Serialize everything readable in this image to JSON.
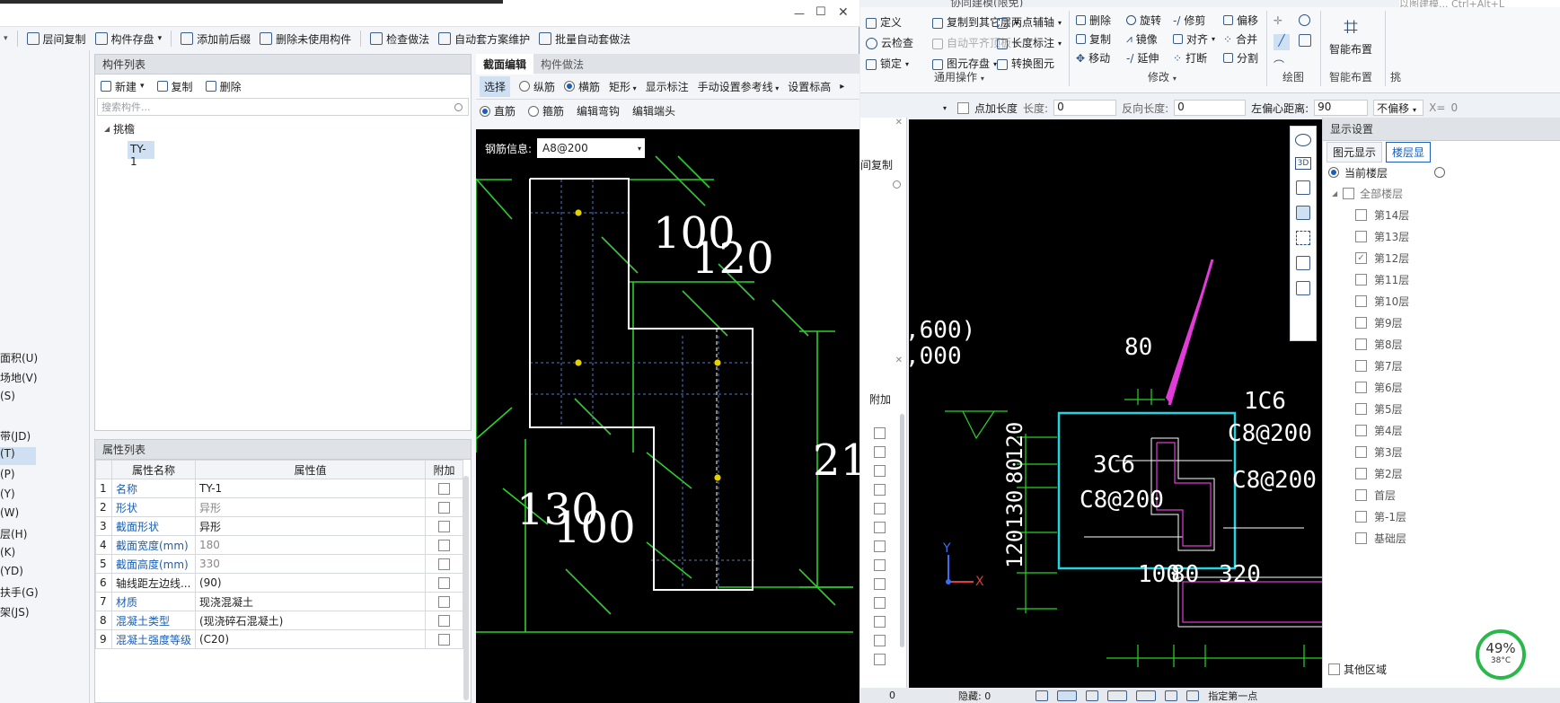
{
  "dialog": {
    "toolbar": [
      {
        "label": "层间复制",
        "icon": "copy-icon"
      },
      {
        "label": "构件存盘",
        "icon": "save-icon"
      },
      {
        "label": "添加前后缀",
        "icon": "prefix-icon"
      },
      {
        "label": "删除未使用构件",
        "icon": "delete-icon"
      },
      {
        "label": "检查做法",
        "icon": "check-icon"
      },
      {
        "label": "自动套方案维护",
        "icon": "scheme-icon"
      },
      {
        "label": "批量自动套做法",
        "icon": "batch-icon"
      }
    ],
    "component_list": {
      "header": "构件列表",
      "actions": [
        {
          "label": "新建"
        },
        {
          "label": "复制"
        },
        {
          "label": "删除"
        }
      ],
      "search_placeholder": "搜索构件...",
      "tree_root": "挑檐",
      "tree_child": "TY-1"
    },
    "property_list": {
      "header": "属性列表",
      "columns": [
        "属性名称",
        "属性值",
        "附加"
      ],
      "rows": [
        {
          "num": "1",
          "name": "名称",
          "value": "TY-1",
          "gray": false
        },
        {
          "num": "2",
          "name": "形状",
          "value": "异形",
          "gray": true
        },
        {
          "num": "3",
          "name": "截面形状",
          "value": "异形",
          "gray": false
        },
        {
          "num": "4",
          "name": "截面宽度(mm)",
          "value": "180",
          "gray": true
        },
        {
          "num": "5",
          "name": "截面高度(mm)",
          "value": "330",
          "gray": true
        },
        {
          "num": "6",
          "name": "轴线距左边线...",
          "value": "(90)",
          "gray": false
        },
        {
          "num": "7",
          "name": "材质",
          "value": "现浇混凝土",
          "gray": false
        },
        {
          "num": "8",
          "name": "混凝土类型",
          "value": "(现浇碎石混凝土)",
          "gray": false
        },
        {
          "num": "9",
          "name": "混凝土强度等级",
          "value": "(C20)",
          "gray": false
        }
      ]
    },
    "section_tabs": [
      {
        "label": "截面编辑",
        "active": true
      },
      {
        "label": "构件做法",
        "active": false
      }
    ],
    "section_toolbar": {
      "select": "选择",
      "long_bar": "纵筋",
      "hbar": "横筋",
      "rect": "矩形",
      "show_dim": "显示标注",
      "ref_line": "手动设置参考线",
      "set_elev": "设置标高"
    },
    "bar_options": {
      "straight": "直筋",
      "stirrup": "箍筋",
      "edit_hook": "编辑弯钩",
      "edit_end": "编辑端头"
    },
    "rebar_info_label": "钢筋信息:",
    "rebar_info_value": "A8@200",
    "dims": {
      "d100a": "100",
      "d120": "120",
      "d130": "130",
      "d100b": "100",
      "d21": "21"
    },
    "window_controls": {
      "minimize": "—",
      "maximize": "☐",
      "close": "✕"
    }
  },
  "left_strip": [
    "面积(U)",
    "场地(V)",
    "(S)",
    "带(JD)",
    "(T)",
    "(P)",
    "(Y)",
    "(W)",
    "层(H)",
    "(K)",
    "(YD)",
    "扶手(G)",
    "架(JS)"
  ],
  "ribbon": {
    "title_partial": "协同建模(限免)",
    "search_placeholder": "以图建模... Ctrl+Alt+L",
    "group1": {
      "items": [
        "定义",
        "云检查",
        "锁定",
        "复制到其它层",
        "自动平齐顶板",
        "图元存盘",
        "两点辅轴",
        "长度标注",
        "转换图元"
      ],
      "caption": "通用操作"
    },
    "group2": {
      "items": [
        "删除",
        "旋转",
        "修剪",
        "偏移",
        "复制",
        "镜像",
        "对齐",
        "合并",
        "移动",
        "延伸",
        "打断",
        "分割"
      ],
      "caption": "修改"
    },
    "group3": {
      "caption": "绘图"
    },
    "group4": {
      "label": "智能布置",
      "caption": "智能布置"
    },
    "group5": {
      "caption": "挑"
    }
  },
  "options_bar": {
    "add_len_label": "点加长度",
    "len_label": "长度:",
    "len_value": "0",
    "rev_label": "反向长度:",
    "rev_value": "0",
    "left_off_label": "左偏心距离:",
    "left_off_value": "90",
    "nooffset": "不偏移",
    "x_label": "X=",
    "x_value": "0"
  },
  "mid_panel": {
    "copy_label": "间复制",
    "extra_header": "附加"
  },
  "cad": {
    "t600": ",600)",
    "t000": ",000",
    "d80": "80",
    "d1c6": "1C6",
    "dc8a": "C8@200",
    "dc8b": "C8@200",
    "d3c6": "3C6",
    "dc8c": "C8@200",
    "v120a": "120",
    "v80": "80",
    "v130": "130",
    "v120b": "120",
    "b100": "100",
    "b80": "80",
    "b320": "320",
    "axis_x": "X",
    "axis_y": "Y"
  },
  "display": {
    "header": "显示设置",
    "tab1": "图元显示",
    "tab2": "楼层显",
    "current_floor": "当前楼层",
    "all_floors": "全部楼层",
    "floors": [
      {
        "label": "第14层",
        "checked": false
      },
      {
        "label": "第13层",
        "checked": false
      },
      {
        "label": "第12层",
        "checked": true
      },
      {
        "label": "第11层",
        "checked": false
      },
      {
        "label": "第10层",
        "checked": false
      },
      {
        "label": "第9层",
        "checked": false
      },
      {
        "label": "第8层",
        "checked": false
      },
      {
        "label": "第7层",
        "checked": false
      },
      {
        "label": "第6层",
        "checked": false
      },
      {
        "label": "第5层",
        "checked": false
      },
      {
        "label": "第4层",
        "checked": false
      },
      {
        "label": "第3层",
        "checked": false
      },
      {
        "label": "第2层",
        "checked": false
      },
      {
        "label": "首层",
        "checked": false
      },
      {
        "label": "第-1层",
        "checked": false
      },
      {
        "label": "基础层",
        "checked": false
      }
    ],
    "other_area": "其他区域"
  },
  "status": {
    "hidden_label": "隐藏: 0",
    "left_num": "0",
    "hint": "指定第一点"
  },
  "perf": {
    "percent": "49%",
    "temp": "38°C"
  }
}
